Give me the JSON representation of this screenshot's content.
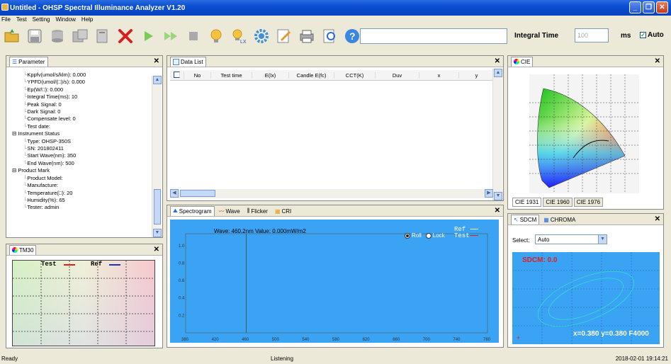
{
  "window": {
    "title": "Untitled - OHSP Spectral Illuminance Analyzer V1.20"
  },
  "menu": [
    "File",
    "Test",
    "Setting",
    "Window",
    "Help"
  ],
  "toolbar": {
    "icons": [
      "folder-open-icon",
      "save-icon",
      "database-icon",
      "export-icon",
      "print-preview-icon",
      "delete-icon",
      "play-icon",
      "fast-forward-icon",
      "stop-icon",
      "bulb-icon",
      "bulb-lx-icon",
      "settings-gear-icon",
      "edit-icon",
      "printer-icon",
      "search-doc-icon",
      "help-icon"
    ],
    "integral_time_label": "Integral Time",
    "integral_time_value": "100",
    "ms_label": "ms",
    "auto_label": "Auto",
    "auto_checked": true
  },
  "parameter_panel": {
    "title": "Parameter",
    "lines": [
      {
        "indent": 1,
        "text": "Kppfv(umol/s/klm): 0.000"
      },
      {
        "indent": 1,
        "text": "YPFD(umol/(□)/s): 0.000"
      },
      {
        "indent": 1,
        "text": "Ep(W/□): 0.000"
      },
      {
        "indent": 1,
        "text": "Integral Time(ms): 10"
      },
      {
        "indent": 1,
        "text": "Peak Signal: 0"
      },
      {
        "indent": 1,
        "text": "Dark Signal: 0"
      },
      {
        "indent": 1,
        "text": "Compensate level: 0"
      },
      {
        "indent": 1,
        "text": "Test date:"
      },
      {
        "indent": 0,
        "text": "Instrument Status"
      },
      {
        "indent": 1,
        "text": "Type: OHSP-350S"
      },
      {
        "indent": 1,
        "text": "SN: 201802411"
      },
      {
        "indent": 1,
        "text": "Start Wave(nm): 350"
      },
      {
        "indent": 1,
        "text": "End Wave(nm): 500"
      },
      {
        "indent": 0,
        "text": "Product Mark"
      },
      {
        "indent": 1,
        "text": "Product Model:"
      },
      {
        "indent": 1,
        "text": "Manufacture:"
      },
      {
        "indent": 1,
        "text": "Temperature(□): 20"
      },
      {
        "indent": 1,
        "text": "Humidity(%): 65"
      },
      {
        "indent": 1,
        "text": "Tester: admin"
      }
    ]
  },
  "tm30_panel": {
    "title": "TM30",
    "test_label": "Test",
    "ref_label": "Ref"
  },
  "data_list": {
    "title": "Data List",
    "columns": [
      "No",
      "Test time",
      "E(lx)",
      "Candle E(fc)",
      "CCT(K)",
      "Duv",
      "x",
      "y"
    ]
  },
  "spectrogram": {
    "tabs": [
      "Spectrogram",
      "Wave",
      "Flicker",
      "CRI"
    ],
    "readout": "Wave: 460.2nm Value: 0.000mW/m2",
    "radio_roll": "Roll",
    "radio_lock": "Lock",
    "legend_ref": "Ref",
    "legend_test": "Test",
    "y_ticks": [
      "1.0",
      "0.8",
      "0.6",
      "0.4",
      "0.2"
    ],
    "x_ticks": [
      "380",
      "420",
      "460",
      "500",
      "540",
      "580",
      "620",
      "660",
      "700",
      "740",
      "780"
    ],
    "cursor_nm": 460.2
  },
  "cie_panel": {
    "title": "CIE",
    "tabs": [
      "CIE 1931",
      "CIE 1960",
      "CIE 1976"
    ]
  },
  "sdcm_panel": {
    "tabs": [
      "SDCM",
      "CHROMA"
    ],
    "select_label": "Select:",
    "select_value": "Auto",
    "sdcm_text": "SDCM: 0.0",
    "xy_text": "x=0.380 y=0.380 F4000"
  },
  "status": {
    "left": "Ready",
    "center": "Listening",
    "right": "2018-02-01 19:14:21"
  }
}
